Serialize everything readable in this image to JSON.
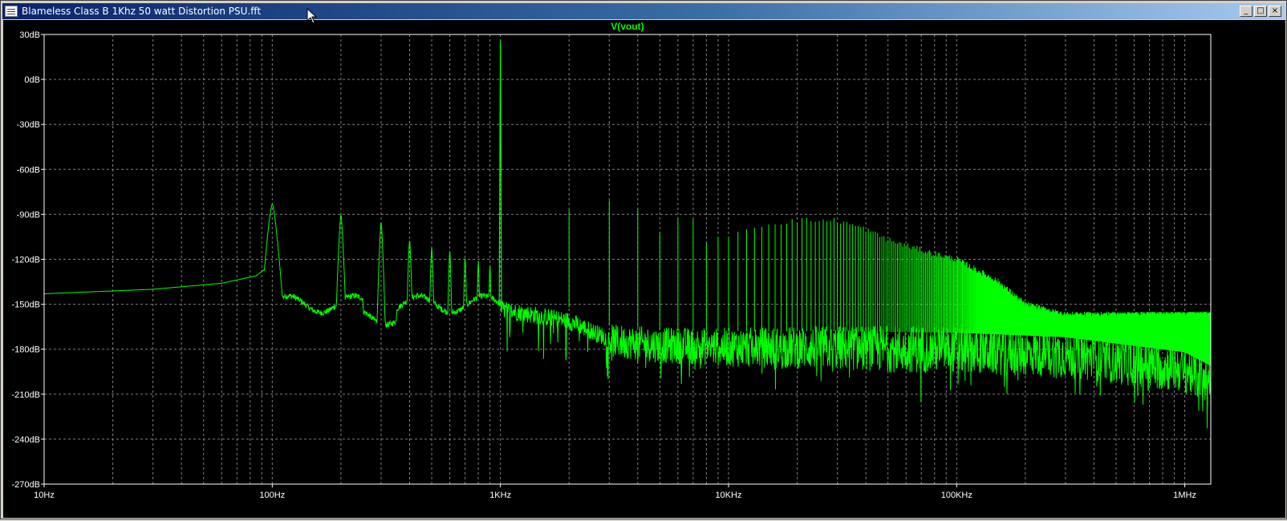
{
  "window": {
    "title": "Blameless Class B 1Khz 50 watt Distortion PSU.fft",
    "controls": {
      "minimize": "_",
      "maximize": "□",
      "close": "×"
    }
  },
  "chart_data": {
    "type": "line",
    "title": "V(vout)",
    "xscale": "log",
    "xlim": [
      10,
      1300000
    ],
    "ylim": [
      -270,
      30
    ],
    "x_ticks": [
      {
        "value": 10,
        "label": "10Hz"
      },
      {
        "value": 100,
        "label": "100Hz"
      },
      {
        "value": 1000,
        "label": "1KHz"
      },
      {
        "value": 10000,
        "label": "10KHz"
      },
      {
        "value": 100000,
        "label": "100KHz"
      },
      {
        "value": 1000000,
        "label": "1MHz"
      }
    ],
    "y_ticks": [
      {
        "value": 30,
        "label": "30dB"
      },
      {
        "value": 0,
        "label": "0dB"
      },
      {
        "value": -30,
        "label": "-30dB"
      },
      {
        "value": -60,
        "label": "-60dB"
      },
      {
        "value": -90,
        "label": "-90dB"
      },
      {
        "value": -120,
        "label": "-120dB"
      },
      {
        "value": -150,
        "label": "-150dB"
      },
      {
        "value": -180,
        "label": "-180dB"
      },
      {
        "value": -210,
        "label": "-210dB"
      },
      {
        "value": -240,
        "label": "-240dB"
      },
      {
        "value": -270,
        "label": "-270dB"
      }
    ],
    "grid": true,
    "colors": {
      "trace": "#00ff00",
      "title": "#00ff00",
      "axis": "#ffffff",
      "grid": "#808080",
      "background": "#000000"
    },
    "series": [
      {
        "name": "V(vout)",
        "low_freq_floor": [
          [
            10,
            -143
          ],
          [
            30,
            -140
          ],
          [
            60,
            -136
          ],
          [
            85,
            -131
          ],
          [
            92,
            -127
          ]
        ],
        "hum_peaks": [
          {
            "f": 100,
            "db": -83
          },
          {
            "f": 200,
            "db": -90
          },
          {
            "f": 300,
            "db": -95
          },
          {
            "f": 400,
            "db": -107
          },
          {
            "f": 500,
            "db": -112
          },
          {
            "f": 600,
            "db": -114
          },
          {
            "f": 700,
            "db": -118
          },
          {
            "f": 800,
            "db": -121
          },
          {
            "f": 900,
            "db": -124
          }
        ],
        "fundamental": {
          "f": 1000,
          "db": 26
        },
        "harmonics": [
          {
            "f": 2000,
            "db": -85
          },
          {
            "f": 3000,
            "db": -82
          },
          {
            "f": 4000,
            "db": -86
          },
          {
            "f": 5000,
            "db": -100
          },
          {
            "f": 6000,
            "db": -94
          },
          {
            "f": 7000,
            "db": -95
          },
          {
            "f": 8000,
            "db": -110
          },
          {
            "f": 10000,
            "db": -103
          },
          {
            "f": 15000,
            "db": -96
          },
          {
            "f": 20000,
            "db": -94
          },
          {
            "f": 30000,
            "db": -94
          },
          {
            "f": 40000,
            "db": -100
          },
          {
            "f": 50000,
            "db": -107
          },
          {
            "f": 70000,
            "db": -114
          },
          {
            "f": 100000,
            "db": -120
          },
          {
            "f": 150000,
            "db": -134
          },
          {
            "f": 200000,
            "db": -150
          },
          {
            "f": 300000,
            "db": -157
          }
        ],
        "noise_floor": [
          [
            1000,
            -152
          ],
          [
            2000,
            -160
          ],
          [
            3000,
            -172
          ],
          [
            5000,
            -175
          ],
          [
            10000,
            -176
          ],
          [
            30000,
            -176
          ],
          [
            100000,
            -177
          ],
          [
            300000,
            -180
          ],
          [
            1000000,
            -190
          ],
          [
            1300000,
            -199
          ]
        ]
      }
    ]
  }
}
